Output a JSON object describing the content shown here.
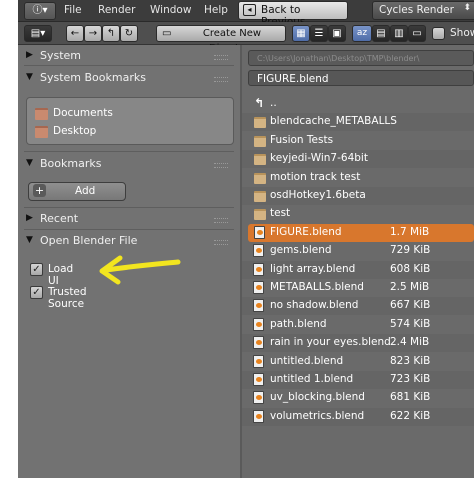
{
  "menubar": {
    "info_icon": "info-icon",
    "menus": [
      "File",
      "Render",
      "Window",
      "Help"
    ],
    "back_button": "Back to Previous",
    "render_engine": "Cycles Render"
  },
  "toolbar": {
    "create_dir_label": "Create New Directory",
    "show_label": "Show"
  },
  "sidebar": {
    "panels": {
      "system": "System",
      "system_bookmarks": "System Bookmarks",
      "bookmarks": "Bookmarks",
      "recent": "Recent",
      "open_blender_file": "Open Blender File"
    },
    "system_bookmarks": [
      "Documents",
      "Desktop"
    ],
    "add_label": "Add",
    "options": [
      {
        "label": "Load UI",
        "checked": true
      },
      {
        "label": "Trusted Source",
        "checked": true
      }
    ]
  },
  "file_browser": {
    "path": "C:\\Users\\Jonathan\\Desktop\\TMP\\blender\\",
    "filename": "FIGURE.blend",
    "entries": [
      {
        "name": "..",
        "type": "parent",
        "size": ""
      },
      {
        "name": "blendcache_METABALLS",
        "type": "folder",
        "size": ""
      },
      {
        "name": "Fusion Tests",
        "type": "folder",
        "size": ""
      },
      {
        "name": "keyjedi-Win7-64bit",
        "type": "folder",
        "size": ""
      },
      {
        "name": "motion track test",
        "type": "folder",
        "size": ""
      },
      {
        "name": "osdHotkey1.6beta",
        "type": "folder",
        "size": ""
      },
      {
        "name": "test",
        "type": "folder",
        "size": ""
      },
      {
        "name": "FIGURE.blend",
        "type": "blend",
        "size": "1.7 MiB",
        "selected": true
      },
      {
        "name": "gems.blend",
        "type": "blend",
        "size": "729 KiB"
      },
      {
        "name": "light array.blend",
        "type": "blend",
        "size": "608 KiB"
      },
      {
        "name": "METABALLS.blend",
        "type": "blend",
        "size": "2.5 MiB"
      },
      {
        "name": "no shadow.blend",
        "type": "blend",
        "size": "667 KiB"
      },
      {
        "name": "path.blend",
        "type": "blend",
        "size": "574 KiB"
      },
      {
        "name": "rain in your eyes.blend",
        "type": "blend",
        "size": "2.4 MiB"
      },
      {
        "name": "untitled.blend",
        "type": "blend",
        "size": "823 KiB"
      },
      {
        "name": "untitled 1.blend",
        "type": "blend",
        "size": "723 KiB"
      },
      {
        "name": "uv_blocking.blend",
        "type": "blend",
        "size": "681 KiB"
      },
      {
        "name": "volumetrics.blend",
        "type": "blend",
        "size": "622 KiB"
      }
    ]
  },
  "colors": {
    "selection": "#d8772d",
    "annotation_arrow": "#f2e51f"
  }
}
